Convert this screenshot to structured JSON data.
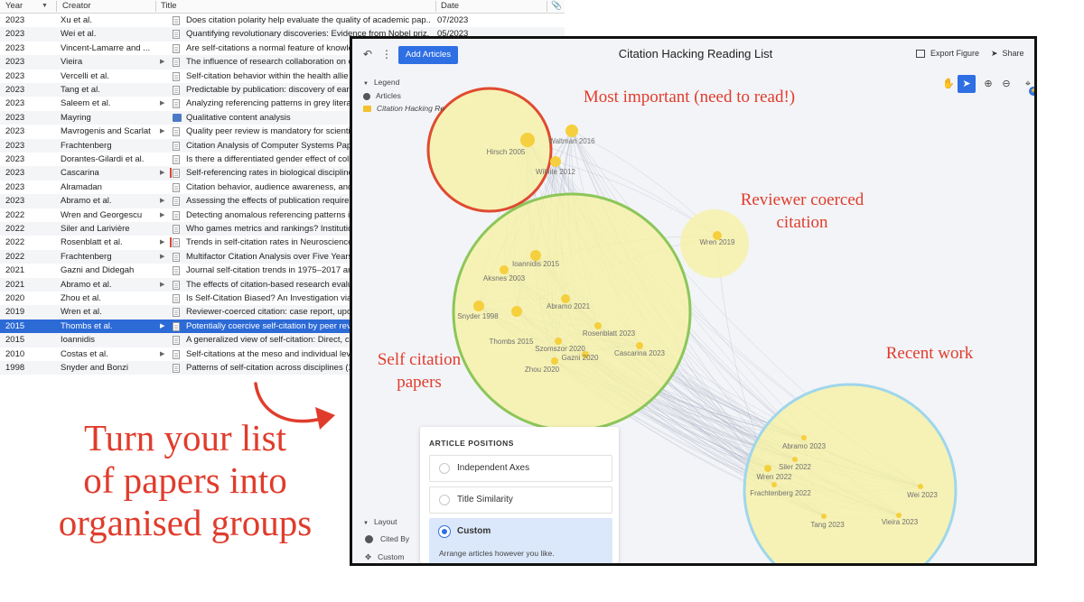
{
  "table": {
    "headers": {
      "year": "Year",
      "creator": "Creator",
      "title": "Title",
      "date": "Date"
    },
    "rows": [
      {
        "year": "2023",
        "creator": "Xu et al.",
        "title": "Does citation polarity help evaluate the quality of academic pap...",
        "date": "07/2023",
        "arrow": "",
        "icon": "doc",
        "pdf": false
      },
      {
        "year": "2023",
        "creator": "Wei et al.",
        "title": "Quantifying revolutionary discoveries: Evidence from Nobel priz...",
        "date": "05/2023",
        "arrow": "",
        "icon": "doc",
        "pdf": false
      },
      {
        "year": "2023",
        "creator": "Vincent-Lamarre and ...",
        "title": "Are self-citations a normal feature of knowle",
        "date": "",
        "arrow": "",
        "icon": "doc",
        "pdf": false
      },
      {
        "year": "2023",
        "creator": "Vieira",
        "title": "The influence of research collaboration on c",
        "date": "",
        "arrow": "▶",
        "icon": "doc",
        "pdf": false
      },
      {
        "year": "2023",
        "creator": "Vercelli et al.",
        "title": "Self-citation behavior within the health allie",
        "date": "",
        "arrow": "",
        "icon": "doc",
        "pdf": false
      },
      {
        "year": "2023",
        "creator": "Tang et al.",
        "title": "Predictable by publication: discovery of early",
        "date": "",
        "arrow": "",
        "icon": "doc",
        "pdf": false
      },
      {
        "year": "2023",
        "creator": "Saleem et al.",
        "title": "Analyzing referencing patterns in grey litera",
        "date": "",
        "arrow": "▶",
        "icon": "doc",
        "pdf": false
      },
      {
        "year": "2023",
        "creator": "Mayring",
        "title": "Qualitative content analysis",
        "date": "",
        "arrow": "",
        "icon": "book",
        "pdf": false
      },
      {
        "year": "2023",
        "creator": "Mavrogenis and Scarlat",
        "title": "Quality peer review is mandatory for scientif",
        "date": "",
        "arrow": "▶",
        "icon": "doc",
        "pdf": false
      },
      {
        "year": "2023",
        "creator": "Frachtenberg",
        "title": "Citation Analysis of Computer Systems Pape",
        "date": "",
        "arrow": "",
        "icon": "doc",
        "pdf": false
      },
      {
        "year": "2023",
        "creator": "Dorantes-Gilardi et al.",
        "title": "Is there a differentiated gender effect of coll",
        "date": "",
        "arrow": "",
        "icon": "doc",
        "pdf": false
      },
      {
        "year": "2023",
        "creator": "Cascarina",
        "title": "Self-referencing rates in biological discipline",
        "date": "",
        "arrow": "▶",
        "icon": "doc",
        "pdf": true
      },
      {
        "year": "2023",
        "creator": "Alramadan",
        "title": "Citation behavior, audience awareness, and",
        "date": "",
        "arrow": "",
        "icon": "doc",
        "pdf": false
      },
      {
        "year": "2023",
        "creator": "Abramo et al.",
        "title": "Assessing the effects of publication requirer",
        "date": "",
        "arrow": "▶",
        "icon": "doc",
        "pdf": false
      },
      {
        "year": "2022",
        "creator": "Wren and Georgescu",
        "title": "Detecting anomalous referencing patterns in",
        "date": "",
        "arrow": "▶",
        "icon": "doc",
        "pdf": false
      },
      {
        "year": "2022",
        "creator": "Siler and Larivière",
        "title": "Who games metrics and rankings? Institution",
        "date": "",
        "arrow": "",
        "icon": "doc",
        "pdf": false
      },
      {
        "year": "2022",
        "creator": "Rosenblatt et al.",
        "title": "Trends in self-citation rates in Neuroscience",
        "date": "",
        "arrow": "▶",
        "icon": "doc",
        "pdf": true
      },
      {
        "year": "2022",
        "creator": "Frachtenberg",
        "title": "Multifactor Citation Analysis over Five Years",
        "date": "",
        "arrow": "▶",
        "icon": "doc",
        "pdf": false
      },
      {
        "year": "2021",
        "creator": "Gazni and Didegah",
        "title": "Journal self-citation trends in 1975–2017 an",
        "date": "",
        "arrow": "",
        "icon": "doc",
        "pdf": false
      },
      {
        "year": "2021",
        "creator": "Abramo et al.",
        "title": "The effects of citation-based research evalu",
        "date": "",
        "arrow": "▶",
        "icon": "doc",
        "pdf": false
      },
      {
        "year": "2020",
        "creator": "Zhou et al.",
        "title": "Is Self-Citation Biased? An Investigation via",
        "date": "",
        "arrow": "",
        "icon": "doc",
        "pdf": false
      },
      {
        "year": "2019",
        "creator": "Wren et al.",
        "title": "Reviewer-coerced citation: case report, upda",
        "date": "",
        "arrow": "",
        "icon": "doc",
        "pdf": false
      },
      {
        "year": "2015",
        "creator": "Thombs et al.",
        "title": "Potentially coercive self-citation by peer rev",
        "date": "",
        "arrow": "▶",
        "icon": "doc",
        "pdf": false,
        "selected": true
      },
      {
        "year": "2015",
        "creator": "Ioannidis",
        "title": "A generalized view of self-citation: Direct, co",
        "date": "",
        "arrow": "",
        "icon": "doc",
        "pdf": false
      },
      {
        "year": "2010",
        "creator": "Costas et al.",
        "title": "Self-citations at the meso and individual lev",
        "date": "",
        "arrow": "▶",
        "icon": "doc",
        "pdf": false
      },
      {
        "year": "1998",
        "creator": "Snyder and Bonzi",
        "title": "Patterns of self-citation across disciplines (1",
        "date": "",
        "arrow": "",
        "icon": "doc",
        "pdf": false
      }
    ]
  },
  "caption": [
    "Turn your list",
    "of papers into",
    "organised groups"
  ],
  "app": {
    "add_button": "Add Articles",
    "title": "Citation Hacking Reading List",
    "export": "Export Figure",
    "share": "Share",
    "legend": {
      "heading": "Legend",
      "articles": "Articles",
      "collection": "Citation Hacking Re"
    },
    "layout": {
      "heading": "Layout",
      "cited_by": "Cited By",
      "custom": "Custom"
    },
    "positions": {
      "title": "ARTICLE POSITIONS",
      "options": [
        "Independent Axes",
        "Title Similarity",
        "Custom"
      ],
      "selected": "Custom",
      "custom_desc": "Arrange articles however you like."
    }
  },
  "groups": {
    "important": {
      "label": [
        "Most important (need to read!)"
      ],
      "stroke": "#e04a2f"
    },
    "reviewer": {
      "label": [
        "Reviewer coerced",
        "citation"
      ],
      "stroke": "none"
    },
    "self": {
      "label": [
        "Self citation",
        "papers"
      ],
      "stroke": "#8cc65a"
    },
    "recent": {
      "label": [
        "Recent work"
      ],
      "stroke": "#9fd6ec"
    }
  },
  "nodes": [
    {
      "label": "Hirsch 2005"
    },
    {
      "label": "Waltman 2016"
    },
    {
      "label": "Wilhite 2012"
    },
    {
      "label": "Wren 2019"
    },
    {
      "label": "Ioannidis 2015"
    },
    {
      "label": "Aksnes 2003"
    },
    {
      "label": "Abramo 2021"
    },
    {
      "label": "Snyder 1998"
    },
    {
      "label": "Rosenblatt 2023"
    },
    {
      "label": "Thombs 2015"
    },
    {
      "label": "Szomszor 2020"
    },
    {
      "label": "Cascarina 2023"
    },
    {
      "label": "Gazni 2020"
    },
    {
      "label": "Zhou 2020"
    },
    {
      "label": "Abramo 2023"
    },
    {
      "label": "Siler 2022"
    },
    {
      "label": "Wren 2022"
    },
    {
      "label": "Frachtenberg 2022"
    },
    {
      "label": "Wei 2023"
    },
    {
      "label": "Tang 2023"
    },
    {
      "label": "Vieira 2023"
    }
  ],
  "colors": {
    "accent": "#2f6fe4",
    "caption_red": "#e03c2c",
    "group_fill": "#f7f1a6",
    "node": "#f5cf3d"
  }
}
